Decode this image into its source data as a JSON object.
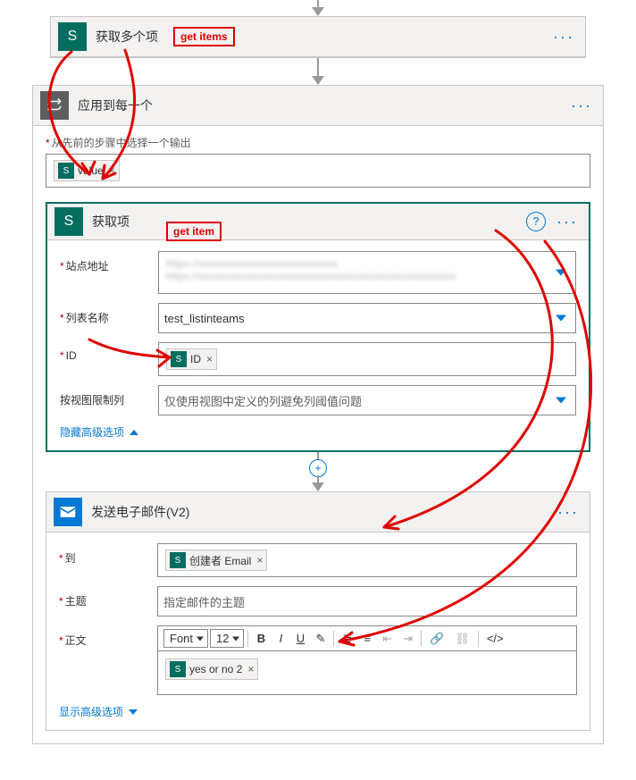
{
  "connector_arrow": "",
  "annotations": {
    "get_items_label": "get items",
    "get_item_label": "get item"
  },
  "step_get_items": {
    "title": "获取多个项"
  },
  "step_apply_each": {
    "title": "应用到每一个",
    "prev_output_label": "从先前的步骤中选择一个输出",
    "token_value": "value"
  },
  "step_get_item": {
    "title": "获取项",
    "fields": {
      "site_label": "站点地址",
      "site_value_blur": "https://xxxxxxxxxxxxxxxxxxxxxxxxxx",
      "list_label": "列表名称",
      "list_value": "test_listinteams",
      "id_label": "ID",
      "id_token": "ID",
      "limit_label": "按视图限制列",
      "limit_placeholder": "仅使用视图中定义的列避免列阈值问题"
    },
    "hide_advanced": "隐藏高级选项"
  },
  "step_send_email": {
    "title": "发送电子邮件(V2)",
    "fields": {
      "to_label": "到",
      "to_token": "创建者 Email",
      "subject_label": "主题",
      "subject_placeholder": "指定邮件的主题",
      "body_label": "正文"
    },
    "toolbar": {
      "font": "Font",
      "size": "12"
    },
    "body_token": "yes or no 2",
    "show_advanced": "显示高级选项"
  }
}
